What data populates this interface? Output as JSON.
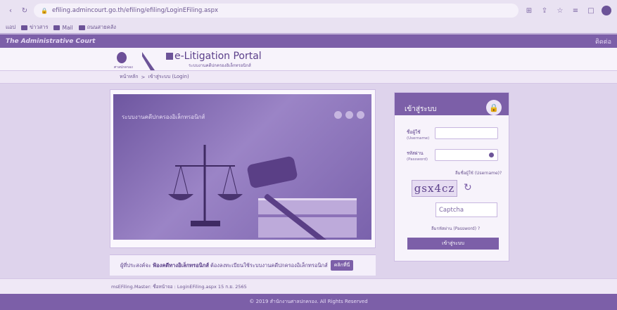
{
  "browser": {
    "url": "efiling.admincourt.go.th/efiling/efiling/LoginEFiling.aspx",
    "bookmarks": [
      "แอป",
      "ข่าวสาร",
      "Mail",
      "ถนนสายคลัง"
    ]
  },
  "site": {
    "top_brand": "The Administrative Court",
    "top_right": "ติดต่อ",
    "emblem_label": "ศาลปกครอง",
    "title": "e-Litigation Portal",
    "subtitle": "ระบบงานคดีปกครองอิเล็กทรอนิกส์"
  },
  "breadcrumb": {
    "home": "หน้าหลัก",
    "sep": ">",
    "current": "เข้าสู่ระบบ (Login)"
  },
  "hero": {
    "caption": "ระบบงานคดีปกครองอิเล็กทรอนิกส์"
  },
  "notice": {
    "prefix": "ผู้ที่ประสงค์จะ",
    "bold": "ฟ้องคดีทางอิเล็กทรอนิกส์",
    "suffix": "ต้องลงทะเบียนใช้ระบบงานคดีปกครองอิเล็กทรอนิกส์",
    "button": "คลิกที่นี่"
  },
  "login": {
    "title": "เข้าสู่ระบบ",
    "username_label": "ชื่อผู้ใช้",
    "username_sub": "(Username)",
    "password_label": "รหัสผ่าน",
    "password_sub": "(Password)",
    "forgot_username": "ลืมชื่อผู้ใช้ (Username)?",
    "captcha_text": "gsx4cz",
    "captcha_placeholder": "Captcha",
    "forgot_password": "ลืมรหัสผ่าน (Password) ?",
    "submit": "เข้าสู่ระบบ"
  },
  "infobar": {
    "text": "msEFiling.Master: ชื่อหน้าจอ : LoginEFiling.aspx 15 ก.ย. 2565"
  },
  "footer": {
    "text": "© 2019 สำนักงานศาลปกครอง. All Rights Reserved"
  }
}
